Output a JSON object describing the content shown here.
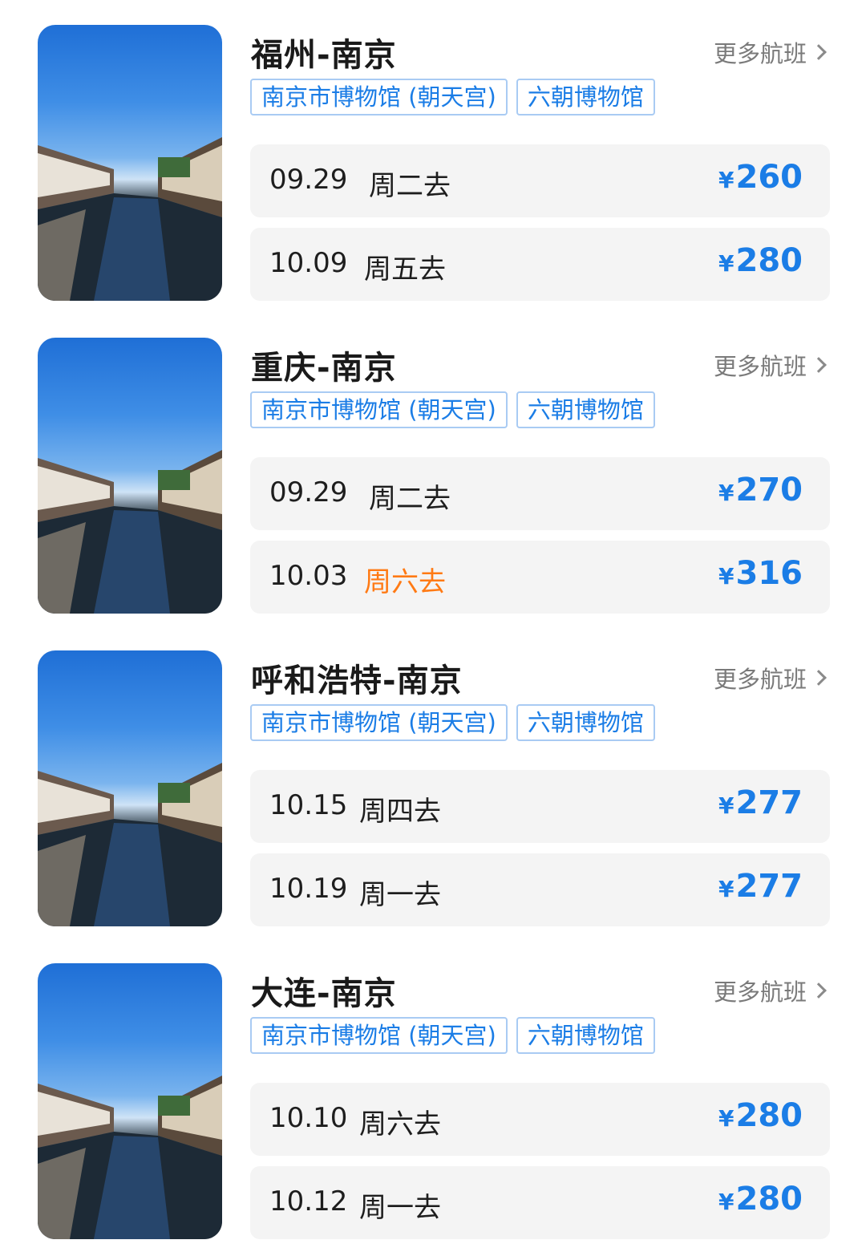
{
  "colors": {
    "accent_blue": "#1b7de6",
    "highlight_orange": "#ff7a14",
    "row_background": "#f4f4f4",
    "tag_border": "#a9cbf3"
  },
  "icons": {
    "thumbnail": "canal-town-photo",
    "more": "chevron-right-icon"
  },
  "cards": [
    {
      "route": "福州-南京",
      "more_label": "更多航班",
      "tags": [
        "南京市博物馆 (朝天宫)",
        "六朝博物馆"
      ],
      "flights": [
        {
          "date": "09.29",
          "day": "周二去",
          "currency": "¥",
          "price": "260",
          "highlight": false
        },
        {
          "date": "10.09",
          "day": "周五去",
          "currency": "¥",
          "price": "280",
          "highlight": false
        }
      ]
    },
    {
      "route": "重庆-南京",
      "more_label": "更多航班",
      "tags": [
        "南京市博物馆 (朝天宫)",
        "六朝博物馆"
      ],
      "flights": [
        {
          "date": "09.29",
          "day": "周二去",
          "currency": "¥",
          "price": "270",
          "highlight": false
        },
        {
          "date": "10.03",
          "day": "周六去",
          "currency": "¥",
          "price": "316",
          "highlight": true
        }
      ]
    },
    {
      "route": "呼和浩特-南京",
      "more_label": "更多航班",
      "tags": [
        "南京市博物馆 (朝天宫)",
        "六朝博物馆"
      ],
      "flights": [
        {
          "date": "10.15",
          "day": "周四去",
          "currency": "¥",
          "price": "277",
          "highlight": false
        },
        {
          "date": "10.19",
          "day": "周一去",
          "currency": "¥",
          "price": "277",
          "highlight": false
        }
      ]
    },
    {
      "route": "大连-南京",
      "more_label": "更多航班",
      "tags": [
        "南京市博物馆 (朝天宫)",
        "六朝博物馆"
      ],
      "flights": [
        {
          "date": "10.10",
          "day": "周六去",
          "currency": "¥",
          "price": "280",
          "highlight": false
        },
        {
          "date": "10.12",
          "day": "周一去",
          "currency": "¥",
          "price": "280",
          "highlight": false
        }
      ]
    }
  ]
}
